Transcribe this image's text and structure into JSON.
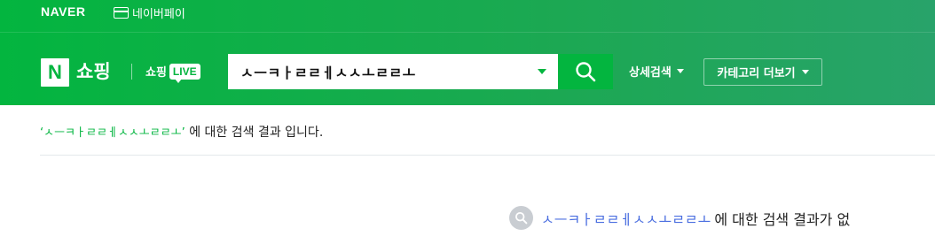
{
  "topbar": {
    "logo": "NAVER",
    "pay_label": "네이버페이",
    "pay_icon": "card-icon"
  },
  "header": {
    "n_logo": "N",
    "shopping_title": "쇼핑",
    "shopping_live_label": "쇼핑",
    "live_badge": "LIVE",
    "search": {
      "value": "ㅅㅡㅋㅏㄹㄹㅔㅅㅅㅗㄹㄹㅗ",
      "icon": "search-icon"
    },
    "detail_search_label": "상세검색",
    "category_more_label": "카테고리 더보기"
  },
  "results": {
    "quote_open": "‘",
    "query": "ㅅㅡㅋㅏㄹㄹㅔㅅㅅㅗㄹㄹㅗ",
    "quote_close": "’",
    "summary_suffix": " 에 대한 검색 결과 입니다.",
    "noresult_query": "ㅅㅡㅋㅏㄹㄹㅔㅅㅅㅗㄹㄹㅗ",
    "noresult_text": "에 대한 검색 결과가 없"
  },
  "colors": {
    "brand_green": "#03b53f",
    "link_blue": "#4a6ee0"
  }
}
